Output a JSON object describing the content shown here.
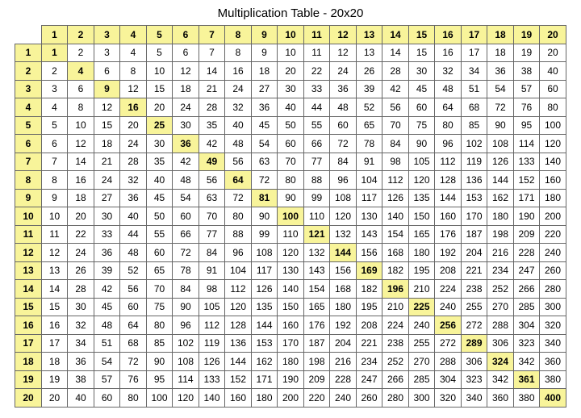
{
  "chart_data": {
    "type": "table",
    "title": "Multiplication Table - 20x20",
    "size": 20
  }
}
